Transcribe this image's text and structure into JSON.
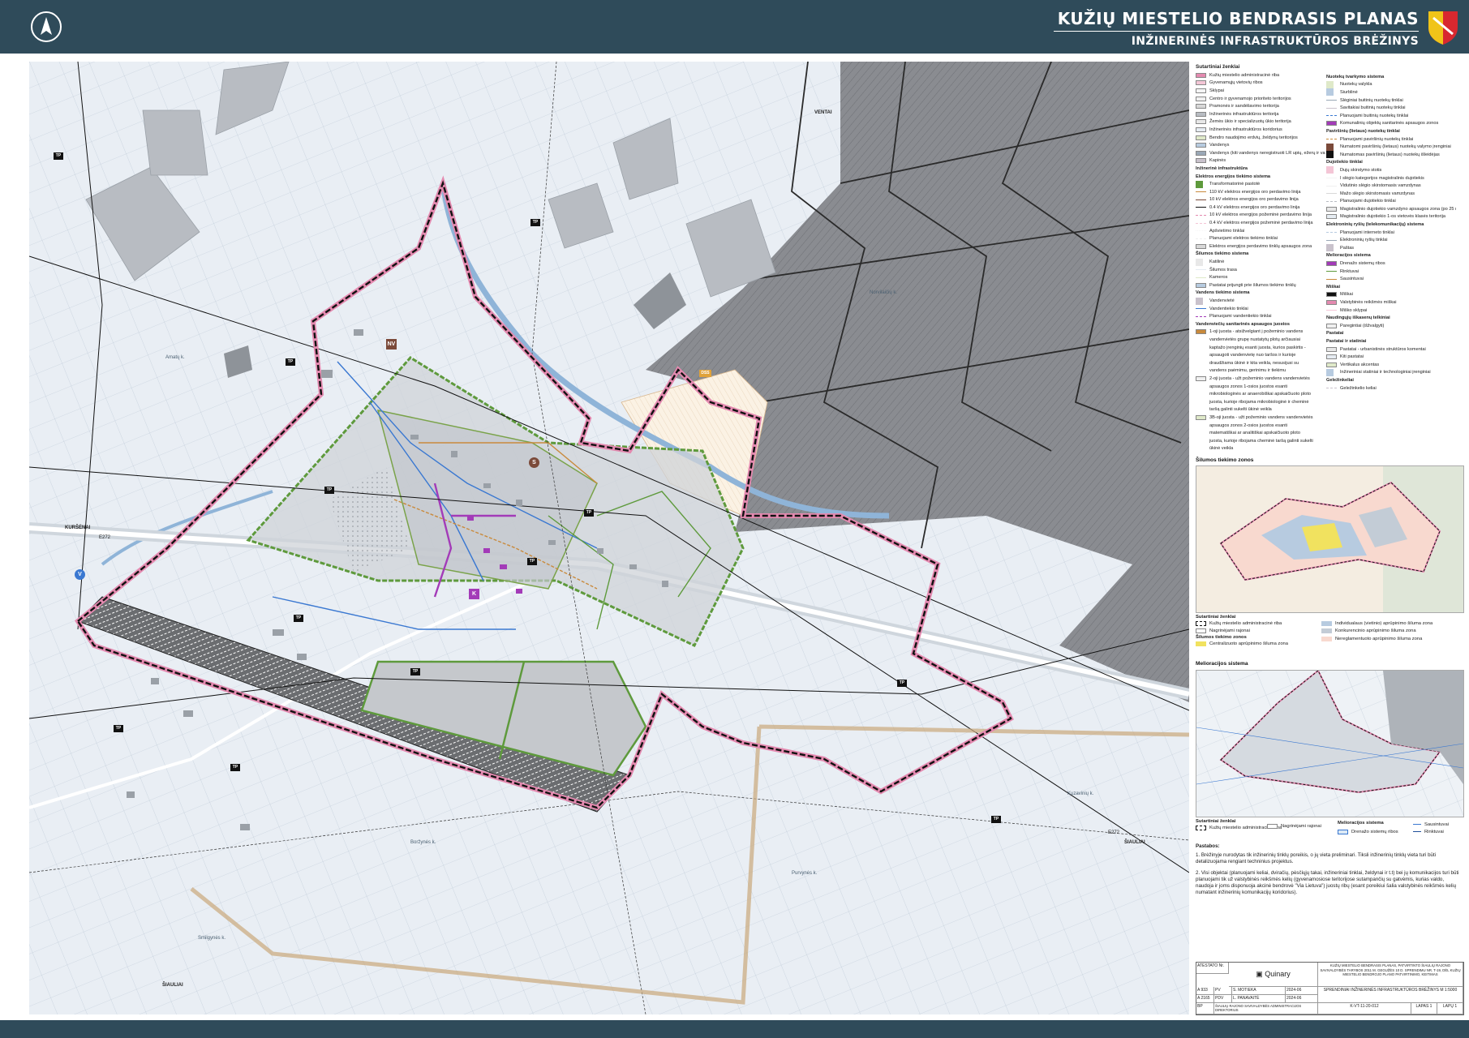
{
  "header": {
    "title": "KUŽIŲ MIESTELIO BENDRASIS PLANAS",
    "subtitle": "INŽINERINĖS INFRASTRUKTŪROS BRĖŽINYS",
    "north_icon": "north-arrow-icon",
    "crest_icon": "municipality-crest-icon"
  },
  "colors": {
    "header_bg": "#2f4b5a",
    "boundary_pink": "#e48ab0",
    "boundary_black": "#111111",
    "forest_gray": "#7d7f84",
    "water_blue": "#8fb4d8",
    "green_network": "#5e9a3c",
    "purple_heating": "#a33bb8",
    "orange_gas": "#c98a3c"
  },
  "map": {
    "place_labels": [
      {
        "text": "Amatų k."
      },
      {
        "text": "Norvilaičių k."
      },
      {
        "text": "KURŠĖNAI"
      },
      {
        "text": "E272"
      },
      {
        "text": "ŠIAULIAI"
      },
      {
        "text": "E272"
      },
      {
        "text": "Kuzavinių k."
      },
      {
        "text": "Boržynės k."
      },
      {
        "text": "Purvynės k."
      },
      {
        "text": "Smilgynės k."
      },
      {
        "text": "ŠIAULIAI"
      },
      {
        "text": "VENTAI"
      }
    ],
    "tp_label": "TP",
    "icons": {
      "nv": "NV",
      "v": "V",
      "k": "K",
      "s": "S",
      "dss": "DSS"
    }
  },
  "legend": {
    "title": "Sutartiniai ženklai",
    "col1": [
      {
        "kind": "fill",
        "text": "Kužių miestelio administracinė riba"
      },
      {
        "kind": "fill",
        "text": "Gyvenamųjų vietovių ribos"
      },
      {
        "kind": "fill",
        "text": "Sklypai"
      },
      {
        "kind": "fill",
        "text": "Centro ir gyvenamojo prioriteto teritorijos"
      },
      {
        "kind": "fill",
        "text": "Pramonės ir sandėliavimo teritorija"
      },
      {
        "kind": "fill",
        "text": "Inžinerinės infrastruktūros teritorija"
      },
      {
        "kind": "fill",
        "text": "Žemės ūkio ir specializuotų ūkio teritorija"
      },
      {
        "kind": "fill",
        "text": "Inžinerinės infrastruktūros koridorius"
      },
      {
        "kind": "fill",
        "text": "Bendro naudojimo erdvių, želdynų teritorijos"
      },
      {
        "kind": "fill",
        "text": "Vandenys"
      },
      {
        "kind": "fill",
        "text": "Vandenys (kiti vandenys neregistruoti LR upių, ežerų ir vandens kadastre)"
      },
      {
        "kind": "fill",
        "text": "Kapinės"
      },
      {
        "kind": "head",
        "text": "Inžinerinė infrastruktūra"
      },
      {
        "kind": "head",
        "text": "Elektros energijos tiekimo sistema"
      },
      {
        "kind": "icon",
        "text": "Transformatorinė pastotė"
      },
      {
        "kind": "line",
        "text": "110 kV elektros energijos oro perdavimo linija"
      },
      {
        "kind": "line",
        "text": "10 kV elektros energijos oro perdavimo linija"
      },
      {
        "kind": "line",
        "text": "0.4 kV elektros energijos oro perdavimo linija"
      },
      {
        "kind": "dash",
        "text": "10 kV elektros energijos požeminė perdavimo linija"
      },
      {
        "kind": "dash",
        "text": "0.4 kV elektros energijos požeminė perdavimo linija"
      },
      {
        "kind": "dot",
        "text": "Apšvietimo tinklai"
      },
      {
        "kind": "dash",
        "text": "Planuojami elektros tiekimo tinklai"
      },
      {
        "kind": "fill",
        "text": "Elektros energijos perdavimo tinklų apsaugos zona"
      },
      {
        "kind": "head",
        "text": "Šilumos tiekimo sistema"
      },
      {
        "kind": "icon",
        "text": "Katilinė"
      },
      {
        "kind": "line",
        "text": "Šilumos trasa"
      },
      {
        "kind": "line",
        "text": "Kameros"
      },
      {
        "kind": "fill",
        "text": "Pastatai prijungti prie šilumos tiekimo tinklų"
      },
      {
        "kind": "head",
        "text": "Vandens tiekimo sistema"
      },
      {
        "kind": "icon",
        "text": "Vandenvietė"
      },
      {
        "kind": "line",
        "text": "Vandentiekio tinklai"
      },
      {
        "kind": "dash",
        "text": "Planuojami vandentiekio tinklai"
      },
      {
        "kind": "head",
        "text": "Vandenviečių sanitarinės apsaugos juostos"
      },
      {
        "kind": "fill",
        "text": "1-oji juosta - atsižvelgiant į požeminio vandens"
      },
      {
        "kind": "text",
        "text": "vandenvietės grupę nustatytų plotų arčiausiai"
      },
      {
        "kind": "text",
        "text": "kaptažo įrenginių esanti juosta, kurios paskirtis -"
      },
      {
        "kind": "text",
        "text": "apsaugoti vandenvietę nuo taršos ir kurioje"
      },
      {
        "kind": "text",
        "text": "draudžiama ūkinė ir kita veikla, nesusijusi su"
      },
      {
        "kind": "text",
        "text": "vandens paėmimu, gerinimu ir tiekimu"
      },
      {
        "kind": "fill",
        "text": "2-oji juosta - užt požeminio vandens vandenvietės"
      },
      {
        "kind": "text",
        "text": "apsaugos zonos 1-osios juostos esanti"
      },
      {
        "kind": "text",
        "text": "mikrobiologinės ar anaerobiškai apskaičiuoto ploto"
      },
      {
        "kind": "text",
        "text": "juosta, kurioje ribojama mikrobiologinė ir cheminė"
      },
      {
        "kind": "text",
        "text": "taršą galinti sukelti ūkinė veikla"
      },
      {
        "kind": "fill",
        "text": "3B-oji juosta - užt požeminio vandens vandenvietės"
      },
      {
        "kind": "text",
        "text": "apsaugos zonos 2-osios juostos esanti"
      },
      {
        "kind": "text",
        "text": "matematiškai ar analitiškai apskaičiuoto ploto"
      },
      {
        "kind": "text",
        "text": "juosta, kurioje ribojama cheminė taršą galinti sukelti"
      },
      {
        "kind": "text",
        "text": "ūkinė veikla"
      }
    ],
    "col2": [
      {
        "kind": "head",
        "text": "Nuotekų tvarkymo sistema"
      },
      {
        "kind": "icon",
        "text": "Nuotekų valykla"
      },
      {
        "kind": "icon",
        "text": "Siurblinė"
      },
      {
        "kind": "line",
        "text": "Slėginiai buitinių nuotekų tinklai"
      },
      {
        "kind": "line",
        "text": "Savitakiai buitinių nuotekų tinklai"
      },
      {
        "kind": "dash",
        "text": "Planuojami buitinių nuotekų tinklai"
      },
      {
        "kind": "fill",
        "text": "Komunalinių objektų sanitarinės apsaugos zonos"
      },
      {
        "kind": "head",
        "text": "Paviršinių (lietaus) nuotekų tinklai"
      },
      {
        "kind": "dash",
        "text": "Planuojami paviršinių nuotekų tinklai"
      },
      {
        "kind": "icon",
        "text": "Numatomi paviršinių (lietaus) nuotekų valymo įrenginiai"
      },
      {
        "kind": "icon",
        "text": "Numatomas paviršinių (lietaus) nuotekų išleidėjas"
      },
      {
        "kind": "head",
        "text": "Dujotiekio tinklai"
      },
      {
        "kind": "icon",
        "text": "Dujų skirstymo stotis"
      },
      {
        "kind": "line",
        "text": "I slėgio kategorijos magistralinis dujotiekis"
      },
      {
        "kind": "line",
        "text": "Vidutinio slėgio skirstomasis vamzdynas"
      },
      {
        "kind": "line",
        "text": "Mažo slėgio skirstomasis vamzdynas"
      },
      {
        "kind": "dash",
        "text": "Planuojami dujotiekio tinklai"
      },
      {
        "kind": "fill",
        "text": "Magistralinio dujotiekio vamzdyno apsaugos zona (po 25 m)"
      },
      {
        "kind": "fill",
        "text": "Magistralinio dujotiekio 1-os vietovės klasės teritorija"
      },
      {
        "kind": "head",
        "text": "Elektroninių ryšių (telekomunikacijų) sistema"
      },
      {
        "kind": "dash",
        "text": "Planuojami interneto tinklai"
      },
      {
        "kind": "line",
        "text": "Elektroninių ryšių tinklai"
      },
      {
        "kind": "icon",
        "text": "Paštas"
      },
      {
        "kind": "head",
        "text": "Melioracijos sistema"
      },
      {
        "kind": "fill",
        "text": "Drenažo sistemų ribos"
      },
      {
        "kind": "line",
        "text": "Rinktuvai"
      },
      {
        "kind": "line",
        "text": "Sausintuvai"
      },
      {
        "kind": "head",
        "text": "Miškai"
      },
      {
        "kind": "fill",
        "text": "Miškai"
      },
      {
        "kind": "fill",
        "text": "Valstybinės reikšmės miškai"
      },
      {
        "kind": "line",
        "text": "Miško sklypai"
      },
      {
        "kind": "head",
        "text": "Naudingųjų iškasenų telkiniai"
      },
      {
        "kind": "fill",
        "text": "Paregintiai (išžvalgyti)"
      },
      {
        "kind": "head",
        "text": "Pastatai"
      },
      {
        "kind": "head",
        "text": "Pastatai ir statiniai"
      },
      {
        "kind": "fill",
        "text": "Pastatai - urbanistinės struktūros komentai"
      },
      {
        "kind": "fill",
        "text": "Kiti pastatai"
      },
      {
        "kind": "fill",
        "text": "Vertikalus akcentas"
      },
      {
        "kind": "icon",
        "text": "Inžineriniai statiniai ir technologiniai įrenginiai"
      },
      {
        "kind": "head",
        "text": "Geležinkeliai"
      },
      {
        "kind": "dash",
        "text": "Geležinkelio keliai"
      }
    ]
  },
  "inset_heat": {
    "title": "Šilumos tiekimo zonos",
    "legend_title": "Sutartiniai ženklai",
    "items_left": [
      "Kužių miestelio administracinė riba",
      "Nagrinėjami rajonai"
    ],
    "sub_title": "Šilumos tiekimo zonos",
    "items_sub": [
      "Centralizuoto aprūpinimo šiluma zona"
    ],
    "items_right": [
      "Individualaus (vietinio) aprūpinimo šiluma zona",
      "Konkurencinio aprūpinimo šiluma zona",
      "Nereglamentuoto aprūpinimo šiluma zona"
    ]
  },
  "inset_melio": {
    "title": "Melioracijos sistema",
    "legend_title": "Sutartiniai ženklai",
    "items": [
      "Kužių miestelio administracinė riba",
      "Nagrinėjami rajonai",
      "Melioracijos sistema",
      "Drenažo sistemų ribos",
      "Sausintuvai",
      "Rinktuvai"
    ]
  },
  "notes": {
    "title": "Pastabos:",
    "p1": "1. Brėžinyje nurodytas tik inžinerinių tinklų poreikis, o jų vieta preliminari. Tiksli inžinerinių tinklų vieta turi būti detalizuojama rengiant techninius projektus.",
    "p2": "2. Visi objektai (planuojami keliai, dviračių, pėsčiųjų takai, inžineriniai tinklai, želdynai ir t.t) bei jų komunikacijos turi būti planuojami tik už valstybinės reikšmės kelių (gyvenamosiose teritorijose sutampančių su gatvėmis, kurias valdo, naudoja ir joms disponuoja akcinė bendrovė \"Via Lietuva\") juostų ribų (esant poreikiui šalia valstybinės reikšmės kelių numatant inžinerinių komunikacijų koridorius)."
  },
  "titleblock": {
    "company": "Quinary",
    "project_text": "KUŽIŲ MIESTELIO BENDRASIS PLANAS, PATVIRTINTO ŠIAULIŲ RAJONO SAVIVALDYBĖS TARYBOS 2011 M. GEGUŽĖS 10 D. SPRENDIMU NR. T-19, DĖL KUŽIŲ MIESTELIO BENDROJO PLANO PATVIRTINIMO, KEITIMAS",
    "drawing": "SPRENDINIAI INŽINERINĖS INFRASTRUKTŪROS BRĖŽINYS M 1:5000",
    "client": "ŠIAULIŲ RAJONO SAVIVALDYBĖS ADMINISTRACIJOS DIREKTORIUS",
    "code": "K-VT-11-20-012",
    "rows": [
      {
        "role": "PV",
        "name": "S. MOTIEKA",
        "date": "2024-06"
      },
      {
        "role": "PDV",
        "name": "L. PANAVAITĖ",
        "date": "2024-06"
      }
    ],
    "sheet": "LAPAS 1",
    "sheets": "LAPŲ 1",
    "stage": "BP",
    "attestation": "ATESTATO Nr.",
    "att_rows": [
      "A 933",
      "A 2165"
    ]
  }
}
